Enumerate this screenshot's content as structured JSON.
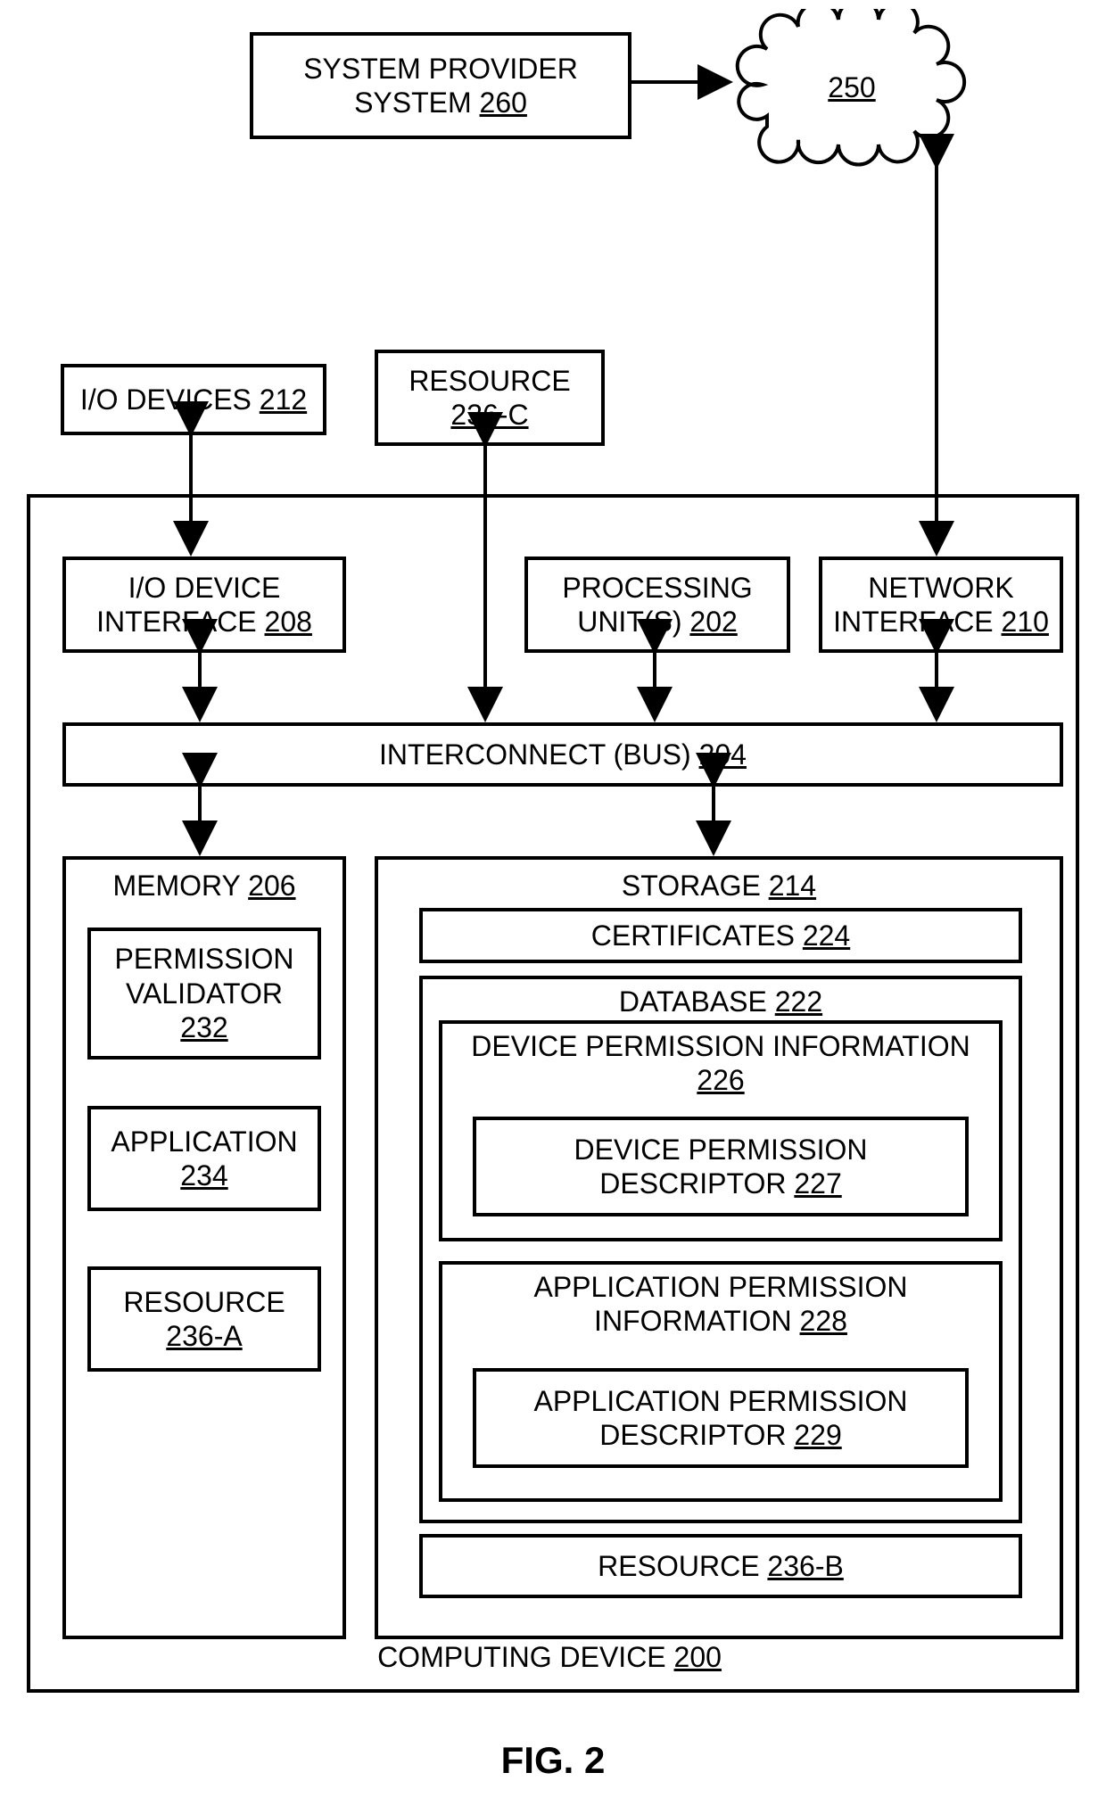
{
  "figure_label": "FIG. 2",
  "blocks": {
    "system_provider": {
      "label": "SYSTEM PROVIDER SYSTEM",
      "ref": "260"
    },
    "cloud": {
      "ref": "250"
    },
    "io_devices": {
      "label": "I/O DEVICES",
      "ref": "212"
    },
    "resource_c": {
      "label": "RESOURCE",
      "ref": "236-C"
    },
    "computing_device": {
      "label": "COMPUTING DEVICE",
      "ref": "200"
    },
    "io_dev_if": {
      "label1": "I/O DEVICE",
      "label2": "INTERFACE",
      "ref": "208"
    },
    "proc_unit": {
      "label1": "PROCESSING",
      "label2": "UNIT(S)",
      "ref": "202"
    },
    "net_if": {
      "label1": "NETWORK",
      "label2": "INTERFACE",
      "ref": "210"
    },
    "interconnect": {
      "label": "INTERCONNECT (BUS)",
      "ref": "204"
    },
    "memory": {
      "label": "MEMORY",
      "ref": "206"
    },
    "perm_validator": {
      "label1": "PERMISSION",
      "label2": "VALIDATOR",
      "ref": "232"
    },
    "application": {
      "label": "APPLICATION",
      "ref": "234"
    },
    "resource_a": {
      "label": "RESOURCE",
      "ref": "236-A"
    },
    "storage": {
      "label": "STORAGE",
      "ref": "214"
    },
    "certificates": {
      "label": "CERTIFICATES",
      "ref": "224"
    },
    "database": {
      "label": "DATABASE",
      "ref": "222"
    },
    "dev_perm_info": {
      "label": "DEVICE PERMISSION INFORMATION",
      "ref": "226"
    },
    "dev_perm_desc": {
      "label1": "DEVICE PERMISSION",
      "label2": "DESCRIPTOR",
      "ref": "227"
    },
    "app_perm_info": {
      "label1": "APPLICATION PERMISSION",
      "label2": "INFORMATION",
      "ref": "228"
    },
    "app_perm_desc": {
      "label1": "APPLICATION PERMISSION",
      "label2": "DESCRIPTOR",
      "ref": "229"
    },
    "resource_b": {
      "label": "RESOURCE",
      "ref": "236-B"
    }
  }
}
